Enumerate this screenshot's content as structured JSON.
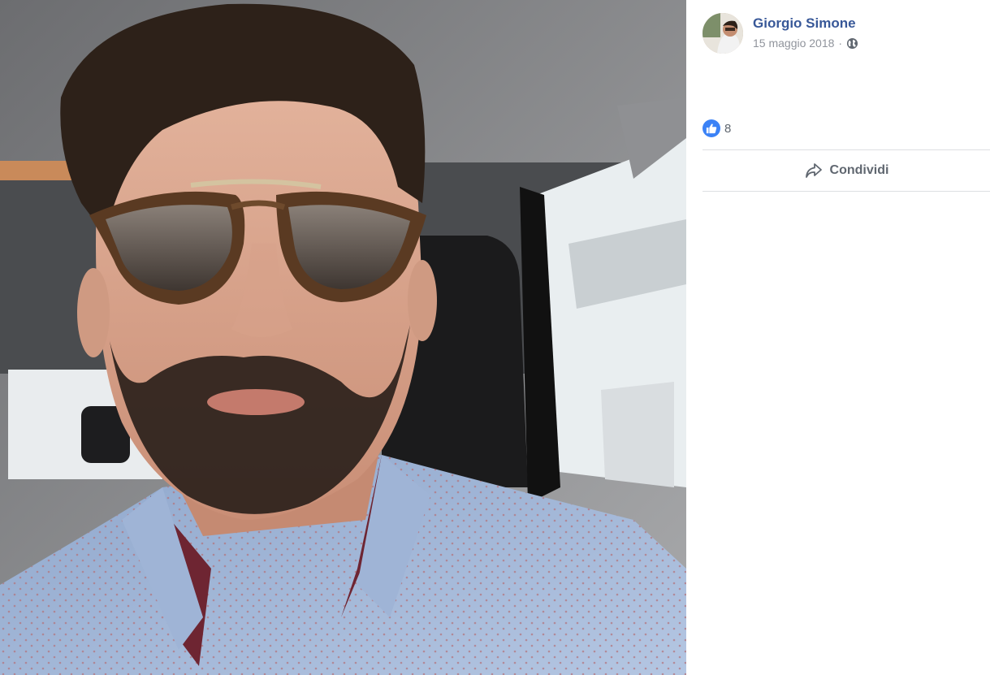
{
  "post": {
    "author_name": "Giorgio Simone",
    "date": "15 maggio 2018",
    "separator": "·",
    "privacy_icon": "globe-icon"
  },
  "reactions": {
    "icon": "like-icon",
    "count": "8"
  },
  "actions": {
    "share_label": "Condividi",
    "share_icon": "share-arrow-icon"
  },
  "colors": {
    "author_link": "#385898",
    "meta_text": "#90949c",
    "like_blue": "#3b82f6",
    "divider": "#dddfe2"
  }
}
